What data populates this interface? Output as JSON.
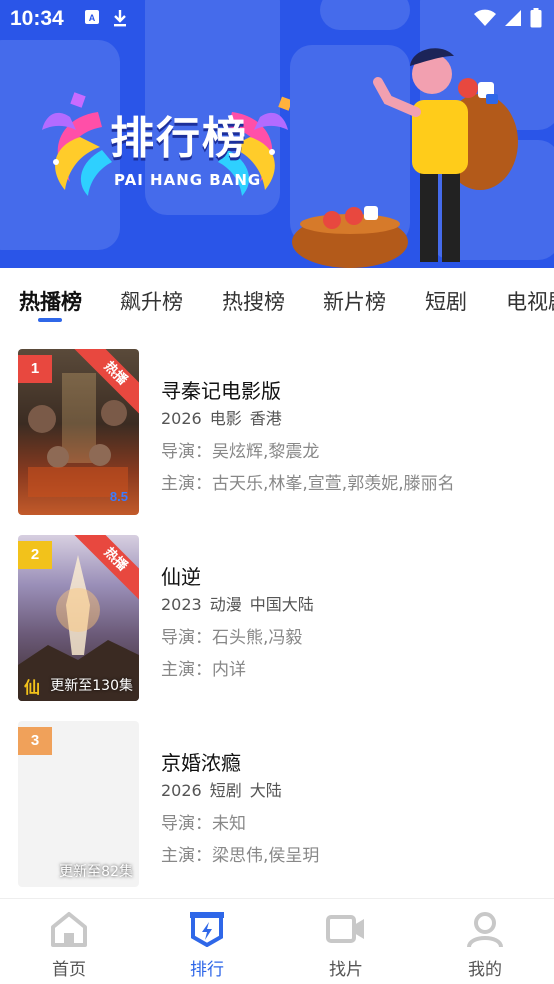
{
  "status": {
    "time": "10:34"
  },
  "banner": {
    "title": "排行榜",
    "subtitle": "PAI HANG BANG"
  },
  "tabs": [
    {
      "label": "热播榜",
      "active": true
    },
    {
      "label": "飙升榜",
      "active": false
    },
    {
      "label": "热搜榜",
      "active": false
    },
    {
      "label": "新片榜",
      "active": false
    },
    {
      "label": "短剧",
      "active": false
    },
    {
      "label": "电视剧",
      "active": false
    }
  ],
  "items": [
    {
      "rank": "1",
      "rank_color": "#e8483f",
      "badge": "热播",
      "episodes": "",
      "title": "寻秦记电影版",
      "year": "2026",
      "genre": "电影",
      "region": "香港",
      "director": "导演：吴炫辉,黎震龙",
      "cast": "主演：古天乐,林峯,宣萱,郭羡妮,滕丽名"
    },
    {
      "rank": "2",
      "rank_color": "#f2c21b",
      "badge": "热播",
      "episodes": "更新至130集",
      "title": "仙逆",
      "year": "2023",
      "genre": "动漫",
      "region": "中国大陆",
      "director": "导演：石头熊,冯毅",
      "cast": "主演：内详"
    },
    {
      "rank": "3",
      "rank_color": "#f0a15a",
      "badge": "",
      "episodes": "更新至82集",
      "title": "京婚浓瘾",
      "year": "2026",
      "genre": "短剧",
      "region": "大陆",
      "director": "导演：未知",
      "cast": "主演：梁思伟,侯呈玥"
    }
  ],
  "bottom_nav": [
    {
      "label": "首页",
      "icon": "home-icon",
      "active": false
    },
    {
      "label": "排行",
      "icon": "ranking-icon",
      "active": true
    },
    {
      "label": "找片",
      "icon": "video-camera-icon",
      "active": false
    },
    {
      "label": "我的",
      "icon": "user-icon",
      "active": false
    }
  ],
  "colors": {
    "accent": "#2f67e8",
    "banner": "#2a55e8",
    "hot": "#e8483f"
  }
}
